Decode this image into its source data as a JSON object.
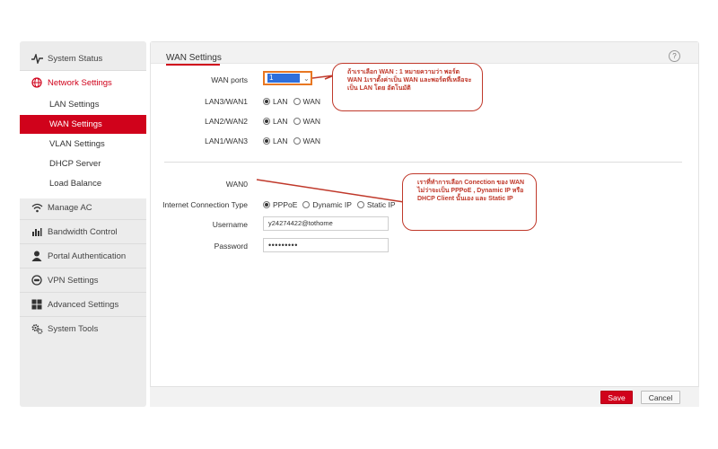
{
  "sidebar": {
    "items": [
      {
        "label": "System Status",
        "icon": "pulse-icon"
      },
      {
        "label": "Network Settings",
        "icon": "globe-icon"
      },
      {
        "label": "Manage AC",
        "icon": "wifi-icon"
      },
      {
        "label": "Bandwidth Control",
        "icon": "bar-chart-icon"
      },
      {
        "label": "Portal Authentication",
        "icon": "user-icon"
      },
      {
        "label": "VPN Settings",
        "icon": "vpn-icon"
      },
      {
        "label": "Advanced Settings",
        "icon": "grid-icon"
      },
      {
        "label": "System Tools",
        "icon": "gears-icon"
      }
    ],
    "subitems": [
      {
        "label": "LAN Settings"
      },
      {
        "label": "WAN Settings"
      },
      {
        "label": "VLAN Settings"
      },
      {
        "label": "DHCP Server"
      },
      {
        "label": "Load Balance"
      }
    ]
  },
  "main": {
    "title": "WAN Settings",
    "help": "?",
    "wan_ports": {
      "label": "WAN ports",
      "value": "1"
    },
    "port_rows": [
      {
        "label": "LAN3/WAN1",
        "options": [
          "LAN",
          "WAN"
        ],
        "selected": "LAN"
      },
      {
        "label": "LAN2/WAN2",
        "options": [
          "LAN",
          "WAN"
        ],
        "selected": "LAN"
      },
      {
        "label": "LAN1/WAN3",
        "options": [
          "LAN",
          "WAN"
        ],
        "selected": "LAN"
      }
    ],
    "wan0": {
      "label": "WAN0"
    },
    "connection_type": {
      "label": "Internet Connection Type",
      "options": [
        "PPPoE",
        "Dynamic IP",
        "Static IP"
      ],
      "selected": "PPPoE"
    },
    "username": {
      "label": "Username",
      "value": "y24274422@tothome"
    },
    "password": {
      "label": "Password",
      "value": "•••••••••"
    }
  },
  "callouts": {
    "wan_ports_note": "ถ้าเราเลือก WAN : 1 หมายความว่า พอร์ต WAN 1เราตั้งค่าเป็น WAN และพอร์ตที่เหลือจะเป็น LAN โดย อัตโนมัติ",
    "connection_note": "เราที่ทำการเลือก Conection ของ WAN ไม่ว่าจะเป็น PPPoE , Dynamic IP หรือ DHCP Client นั้นเอง และ Static IP"
  },
  "footer": {
    "save_label": "Save",
    "cancel_label": "Cancel"
  },
  "colors": {
    "accent": "#d0021b",
    "callout": "#c0392b",
    "select_highlight": "#2f6fdb",
    "select_border": "#e87722"
  }
}
